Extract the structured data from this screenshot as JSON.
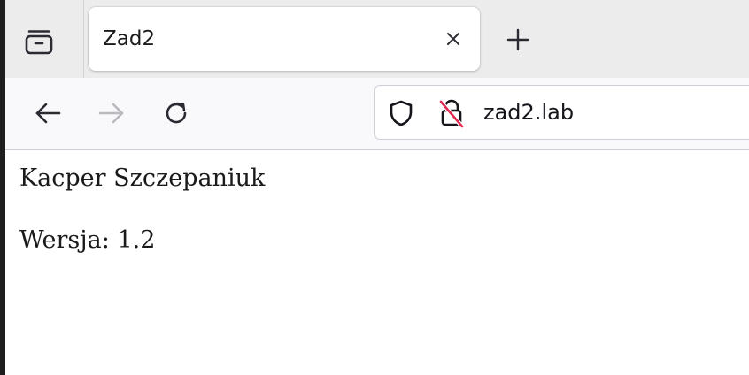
{
  "browser": {
    "tab": {
      "title": "Zad2"
    },
    "address_bar": {
      "url": "zad2.lab"
    },
    "icons": {
      "tabs_list": "tabs-list-icon",
      "close": "close-icon",
      "new_tab": "plus-icon",
      "back": "back-arrow-icon",
      "forward": "forward-arrow-icon",
      "reload": "reload-icon",
      "tracking_protection": "shield-icon",
      "insecure_connection": "insecure-lock-icon"
    },
    "colors": {
      "insecure_slash": "#e22850",
      "tabstrip_bg": "#ececec",
      "navbar_bg": "#f9f9fb"
    }
  },
  "page": {
    "author": "Kacper Szczepaniuk",
    "version_line": "Wersja: 1.2"
  }
}
